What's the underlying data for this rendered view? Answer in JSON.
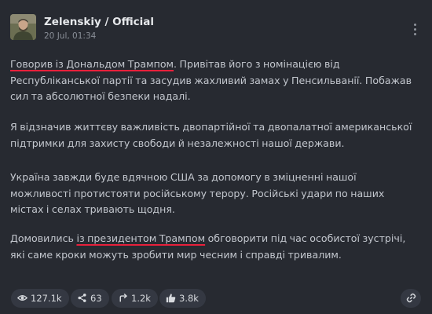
{
  "post": {
    "author": "Zelenskiy / Official",
    "timestamp": "20 Jul, 01:34",
    "paragraphs": [
      {
        "segments": [
          {
            "text": "Говорив із Дональдом Трампом",
            "underline": true
          },
          {
            "text": ". Привітав його з номінацією від Республіканської партії та засудив жахливий замах у Пенсильванії. Побажав сил та абсолютної безпеки надалі.",
            "underline": false
          }
        ]
      },
      {
        "segments": [
          {
            "text": "Я відзначив життєву важливість двопартійної та двопалатної американської підтримки для захисту свободи й незалежності нашої держави.",
            "underline": false
          }
        ]
      },
      {
        "segments": [
          {
            "text": "Україна завжди буде вдячною США за допомогу в зміцненні нашої можливості протистояти російському терору. Російські удари по наших містах і селах тривають щодня.",
            "underline": false
          }
        ]
      },
      {
        "segments": [
          {
            "text": "Домовились ",
            "underline": false
          },
          {
            "text": "із президентом Трампом",
            "underline": true
          },
          {
            "text": " обговорити під час особистої зустрічі, які саме кроки можуть зробити мир чесним і справді тривалим.",
            "underline": false
          }
        ]
      }
    ]
  },
  "stats": {
    "views": "127.1k",
    "shares": "63",
    "forwards": "1.2k",
    "reactions": "3.8k"
  },
  "icons": {
    "views": "eye-icon",
    "shares": "share-icon",
    "forwards": "forward-arrow-icon",
    "reactions": "thumbs-up-icon",
    "link": "link-icon",
    "menu": "more-vertical-icon"
  },
  "colors": {
    "background": "#272a31",
    "underline_accent": "#e8203b",
    "pill": "#343842"
  }
}
